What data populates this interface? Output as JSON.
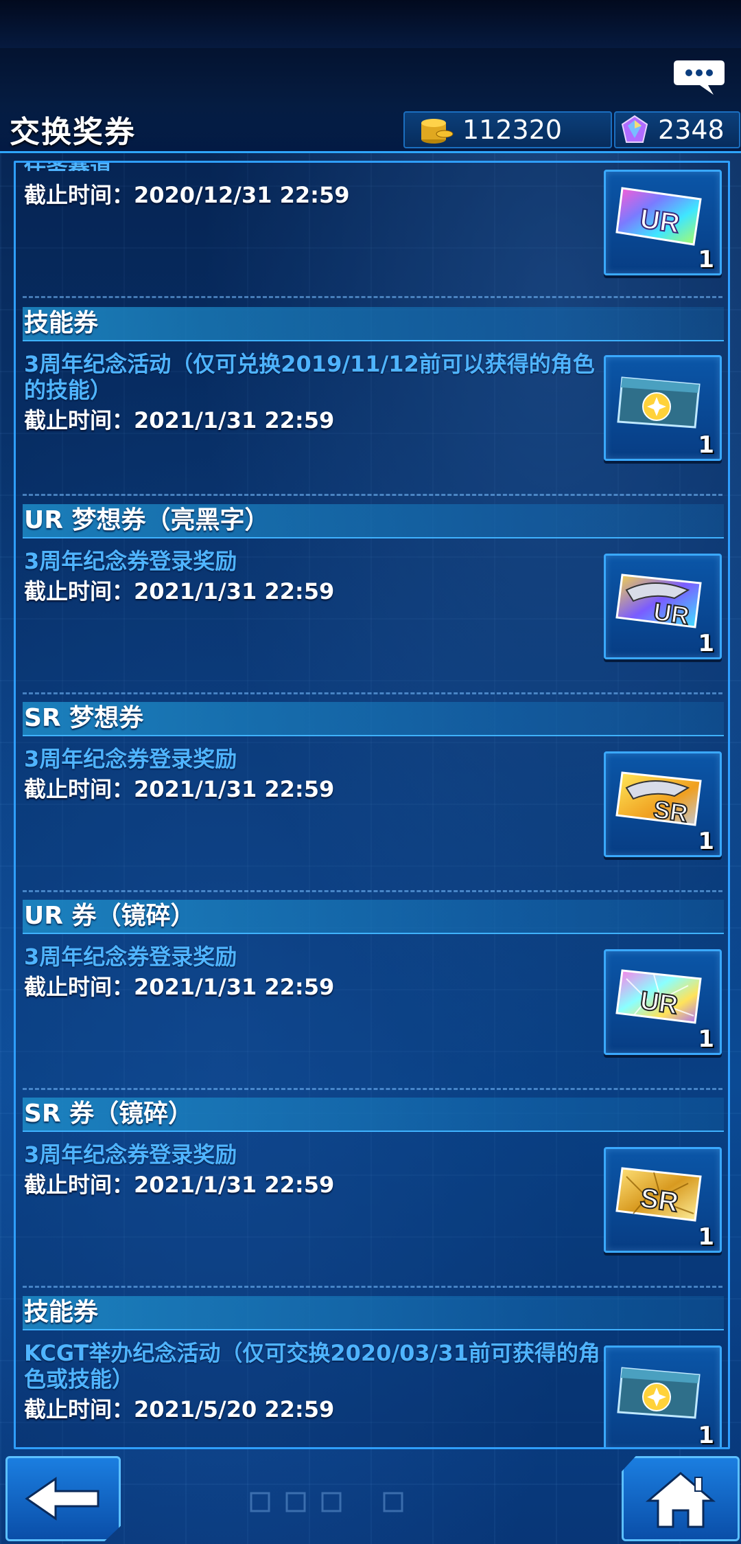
{
  "header": {
    "title": "交换奖券",
    "coins": "112320",
    "gems": "2348"
  },
  "items": [
    {
      "section": "",
      "title_fragment": "任务赛道",
      "deadline": "截止时间：2020/12/31 22:59",
      "ticket": {
        "icon": "ur-ticket-icon",
        "label": "UR",
        "quantity": "1"
      }
    },
    {
      "section": "技能券",
      "title": "3周年纪念活动（仅可兑换2019/11/12前可以获得的角色的技能）",
      "deadline": "截止时间：2021/1/31 22:59",
      "ticket": {
        "icon": "skill-ticket-icon",
        "quantity": "1"
      }
    },
    {
      "section": "UR 梦想券（亮黑字）",
      "title": "3周年纪念券登录奖励",
      "deadline": "截止时间：2021/1/31 22:59",
      "ticket": {
        "icon": "ur-dream-ticket-icon",
        "label": "UR",
        "quantity": "1"
      }
    },
    {
      "section": "SR 梦想券",
      "title": "3周年纪念券登录奖励",
      "deadline": "截止时间：2021/1/31 22:59",
      "ticket": {
        "icon": "sr-dream-ticket-icon",
        "label": "SR",
        "quantity": "1"
      }
    },
    {
      "section": "UR 券（镜碎）",
      "title": "3周年纪念券登录奖励",
      "deadline": "截止时间：2021/1/31 22:59",
      "ticket": {
        "icon": "ur-shatter-ticket-icon",
        "label": "UR",
        "quantity": "1"
      }
    },
    {
      "section": "SR 券（镜碎）",
      "title": "3周年纪念券登录奖励",
      "deadline": "截止时间：2021/1/31 22:59",
      "ticket": {
        "icon": "sr-shatter-ticket-icon",
        "label": "SR",
        "quantity": "1"
      }
    },
    {
      "section": "技能券",
      "title": "KCGT举办纪念活动（仅可交换2020/03/31前可获得的角色或技能）",
      "deadline": "截止时间：2021/5/20 22:59",
      "ticket": {
        "icon": "skill-ticket-icon",
        "quantity": "1"
      }
    }
  ],
  "colors": {
    "accent": "#2f9fff",
    "title_blue": "#4fb4ff"
  },
  "nav": {
    "back_icon": "arrow-left-icon",
    "home_icon": "home-icon"
  }
}
